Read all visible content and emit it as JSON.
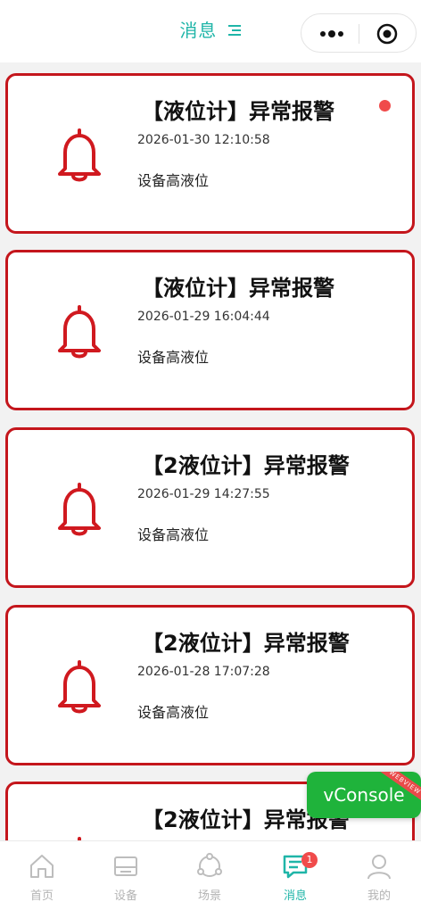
{
  "header": {
    "title": "消息"
  },
  "messages": [
    {
      "title": "【液位计】异常报警",
      "time": "2026-01-30 12:10:58",
      "desc": "设备高液位",
      "unread": true
    },
    {
      "title": "【液位计】异常报警",
      "time": "2026-01-29 16:04:44",
      "desc": "设备高液位",
      "unread": false
    },
    {
      "title": "【2液位计】异常报警",
      "time": "2026-01-29 14:27:55",
      "desc": "设备高液位",
      "unread": false
    },
    {
      "title": "【2液位计】异常报警",
      "time": "2026-01-28 17:07:28",
      "desc": "设备高液位",
      "unread": false
    },
    {
      "title": "【2液位计】异常报警",
      "time": "",
      "desc": "",
      "unread": false
    }
  ],
  "vconsole": {
    "label": "vConsole",
    "ribbon": "WEBVIEW"
  },
  "tabbar": {
    "tabs": [
      {
        "label": "首页",
        "icon": "home-icon"
      },
      {
        "label": "设备",
        "icon": "device-icon"
      },
      {
        "label": "场景",
        "icon": "scene-icon"
      },
      {
        "label": "消息",
        "icon": "message-icon",
        "badge": "1",
        "active": true
      },
      {
        "label": "我的",
        "icon": "user-icon"
      }
    ]
  },
  "colors": {
    "accent": "#1fb5a8",
    "alarm_red": "#c4161c",
    "badge_red": "#f04b4b",
    "vconsole_green": "#1fb33b"
  }
}
